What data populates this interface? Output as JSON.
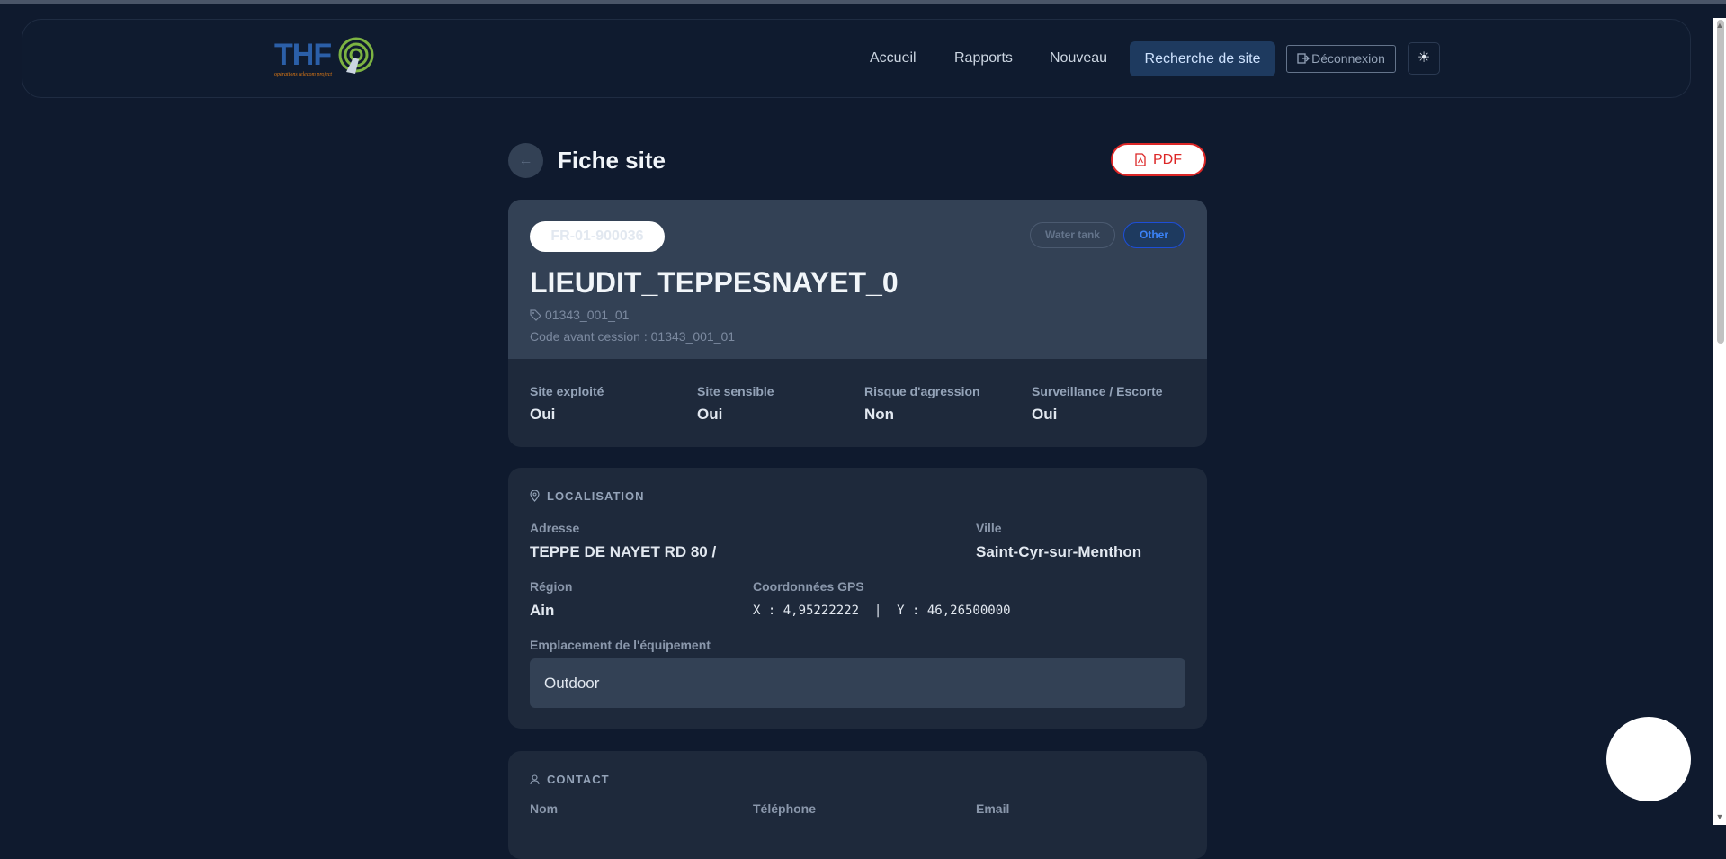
{
  "header": {
    "logo": {
      "text": "THF",
      "tagline": "opérations telecom project"
    },
    "nav": [
      {
        "label": "Accueil"
      },
      {
        "label": "Rapports"
      },
      {
        "label": "Nouveau"
      },
      {
        "label": "Recherche de site",
        "active": true
      }
    ],
    "logout_label": "Déconnexion",
    "theme_icon": "sun-icon"
  },
  "page": {
    "title": "Fiche site",
    "back_icon": "arrow-left-icon",
    "pdf_label": "PDF"
  },
  "site": {
    "code": "FR-01-900036",
    "badges": [
      "Water tank",
      "Other"
    ],
    "name": "LIEUDIT_TEPPESNAYET_0",
    "tag": "01343_001_01",
    "code_avant_cession": "Code avant cession : 01343_001_01",
    "stats": [
      {
        "label": "Site exploité",
        "value": "Oui"
      },
      {
        "label": "Site sensible",
        "value": "Oui"
      },
      {
        "label": "Risque d'agression",
        "value": "Non"
      },
      {
        "label": "Surveillance / Escorte",
        "value": "Oui"
      }
    ]
  },
  "localisation": {
    "heading": "LOCALISATION",
    "adresse_label": "Adresse",
    "adresse": "TEPPE DE NAYET RD 80 /",
    "ville_label": "Ville",
    "ville": "Saint-Cyr-sur-Menthon",
    "region_label": "Région",
    "region": "Ain",
    "gps_label": "Coordonnées GPS",
    "gps": "X : 4,95222222  |  Y : 46,26500000",
    "equip_label": "Emplacement de l'équipement",
    "equip": "Outdoor"
  },
  "contact": {
    "heading": "CONTACT",
    "nom_label": "Nom",
    "tel_label": "Téléphone",
    "email_label": "Email"
  },
  "colors": {
    "background": "#0f1a2e",
    "card": "#1e293b",
    "accent": "#3b82f6",
    "danger": "#dc2626"
  }
}
